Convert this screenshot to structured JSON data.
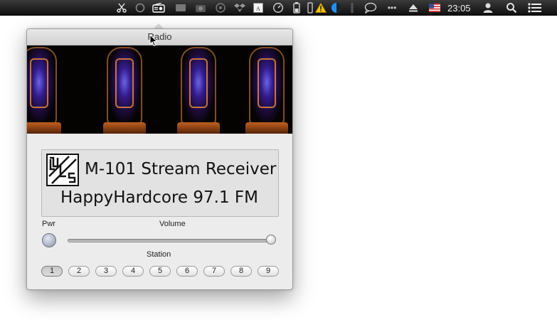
{
  "menubar": {
    "clock": "23:05",
    "icons": [
      "scissors-icon",
      "gear-outline-icon",
      "radio-icon",
      "display-icon",
      "camera-icon",
      "timer-icon",
      "dropbox-icon",
      "text-icon",
      "speedometer-icon",
      "battery-icon",
      "warning-icon",
      "half-circle-icon",
      "sync-icon",
      "chat-bubble-icon",
      "ellipsis-icon",
      "eject-icon",
      "us-flag-icon",
      "user-icon",
      "search-icon",
      "list-icon"
    ]
  },
  "window": {
    "title": "Radio"
  },
  "display": {
    "title": "M-101 Stream Receiver",
    "station": "HappyHardcore 97.1 FM"
  },
  "controls": {
    "power_label": "Pwr",
    "volume_label": "Volume",
    "volume_level": 1.0,
    "station_label": "Station",
    "stations": [
      "1",
      "2",
      "3",
      "4",
      "5",
      "6",
      "7",
      "8",
      "9"
    ],
    "active_station": "1"
  }
}
